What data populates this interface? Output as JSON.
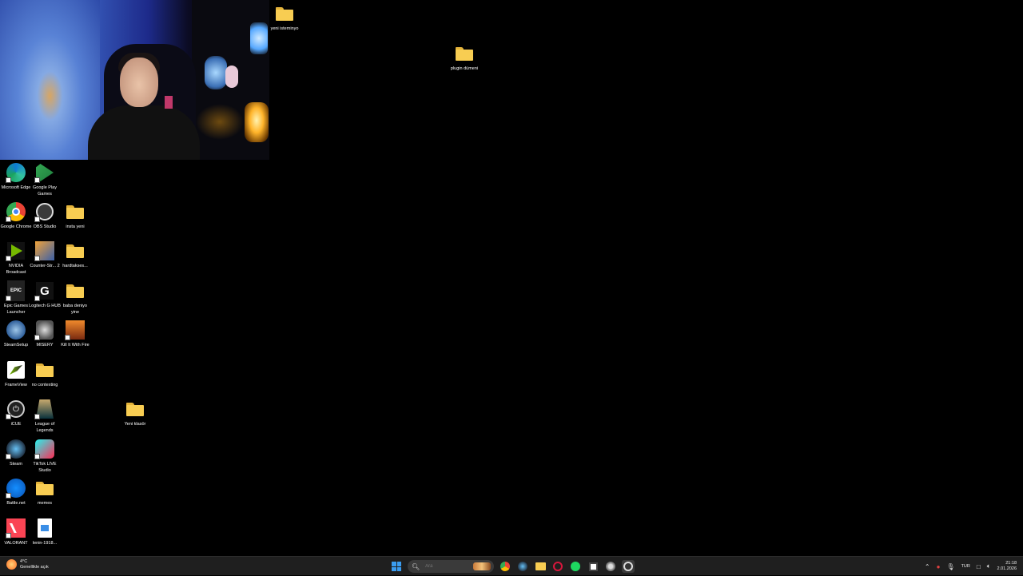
{
  "desktop": {
    "icons": [
      {
        "label": "Microsoft Edge",
        "icon": "edge-icon"
      },
      {
        "label": "Google Play Games",
        "icon": "google-play-games-icon"
      },
      {
        "label": "Google Chrome",
        "icon": "chrome-icon"
      },
      {
        "label": "OBS Studio",
        "icon": "obs-icon"
      },
      {
        "label": "insta yeni",
        "icon": "folder-icon"
      },
      {
        "label": "NVIDIA Broadcast",
        "icon": "nvidia-broadcast-icon"
      },
      {
        "label": "Counter-Str... 2",
        "icon": "counter-strike-icon"
      },
      {
        "label": "hardtakses...",
        "icon": "folder-icon"
      },
      {
        "label": "Epic Games Launcher",
        "icon": "epic-games-icon"
      },
      {
        "label": "Logitech G HUB",
        "icon": "logitech-icon"
      },
      {
        "label": "baba deniyo yine",
        "icon": "folder-icon"
      },
      {
        "label": "SteamSetup",
        "icon": "steam-setup-icon"
      },
      {
        "label": "MISERY",
        "icon": "misery-icon"
      },
      {
        "label": "Kill It With Fire",
        "icon": "kill-it-with-fire-icon"
      },
      {
        "label": "FrameView",
        "icon": "frameview-icon"
      },
      {
        "label": "no contexting",
        "icon": "folder-icon"
      },
      {
        "label": "iCUE",
        "icon": "icue-icon"
      },
      {
        "label": "League of Legends",
        "icon": "league-of-legends-icon"
      },
      {
        "label": "Steam",
        "icon": "steam-icon"
      },
      {
        "label": "TikTok LIVE Studio",
        "icon": "tiktok-live-icon"
      },
      {
        "label": "Battle.net",
        "icon": "battlenet-icon"
      },
      {
        "label": "memes",
        "icon": "folder-icon"
      },
      {
        "label": "VALORANT",
        "icon": "valorant-icon"
      },
      {
        "label": "lenin-1918...",
        "icon": "image-file-icon"
      },
      {
        "label": "Yeni klasör",
        "icon": "folder-icon"
      },
      {
        "label": "yeni isteminyo",
        "icon": "folder-icon"
      },
      {
        "label": "plugin dümeni",
        "icon": "folder-icon"
      }
    ]
  },
  "taskbar": {
    "weather": {
      "temp": "4°C",
      "desc": "Genellikle açık"
    },
    "search": {
      "placeholder": "Ara"
    },
    "apps": [
      "start-icon",
      "search-icon",
      "chrome-icon",
      "steam-icon",
      "file-explorer-icon",
      "opera-gx-icon",
      "spotify-icon",
      "window-icon",
      "settings-icon",
      "obs-icon"
    ],
    "tray": {
      "lang": "TUR",
      "time": "21:18",
      "date": "2.01.2026"
    }
  },
  "colors": {
    "folder": "#f8cd52",
    "taskbar": "#1f1f1f",
    "accent": "#3a9cf0"
  }
}
